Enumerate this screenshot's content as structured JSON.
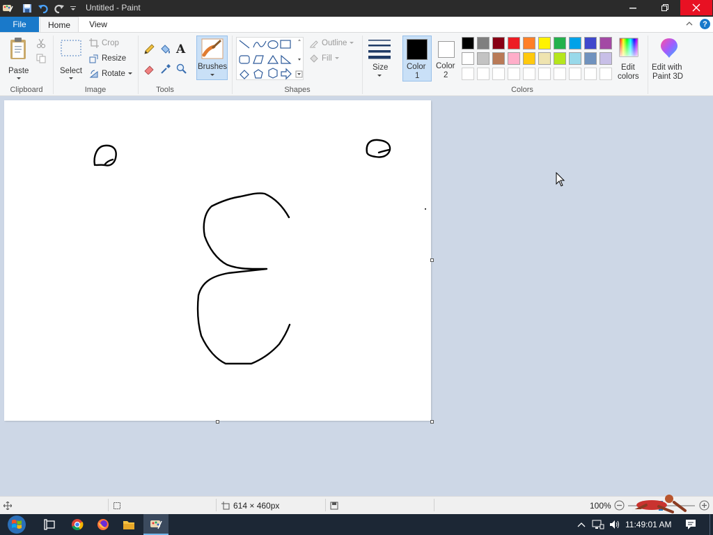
{
  "window": {
    "title": "Untitled - Paint"
  },
  "tabs": {
    "file": "File",
    "home": "Home",
    "view": "View"
  },
  "ribbon": {
    "clipboard": {
      "label": "Clipboard",
      "paste": "Paste"
    },
    "image": {
      "label": "Image",
      "select": "Select",
      "crop": "Crop",
      "resize": "Resize",
      "rotate": "Rotate"
    },
    "tools": {
      "label": "Tools"
    },
    "brushes": {
      "label": "Brushes"
    },
    "shapes": {
      "label": "Shapes",
      "outline": "Outline",
      "fill": "Fill"
    },
    "size": {
      "label": "Size"
    },
    "color1": {
      "label_line1": "Color",
      "label_line2": "1",
      "value": "#000000"
    },
    "color2": {
      "label_line1": "Color",
      "label_line2": "2",
      "value": "#ffffff"
    },
    "colors": {
      "label": "Colors",
      "row1": [
        "#000000",
        "#7f7f7f",
        "#880015",
        "#ed1c24",
        "#ff7f27",
        "#fff200",
        "#22b14c",
        "#00a2e8",
        "#3f48cc",
        "#a349a4"
      ],
      "row2": [
        "#ffffff",
        "#c3c3c3",
        "#b97a57",
        "#ffaec9",
        "#ffc90e",
        "#efe4b0",
        "#b5e61d",
        "#99d9ea",
        "#7092be",
        "#c8bfe7"
      ]
    },
    "edit_colors": {
      "line1": "Edit",
      "line2": "colors"
    },
    "paint3d": {
      "line1": "Edit with",
      "line2": "Paint 3D"
    }
  },
  "statusbar": {
    "canvas_size": "614 × 460px",
    "zoom": "100%"
  },
  "taskbar": {
    "clock": "11:49:01 AM"
  }
}
